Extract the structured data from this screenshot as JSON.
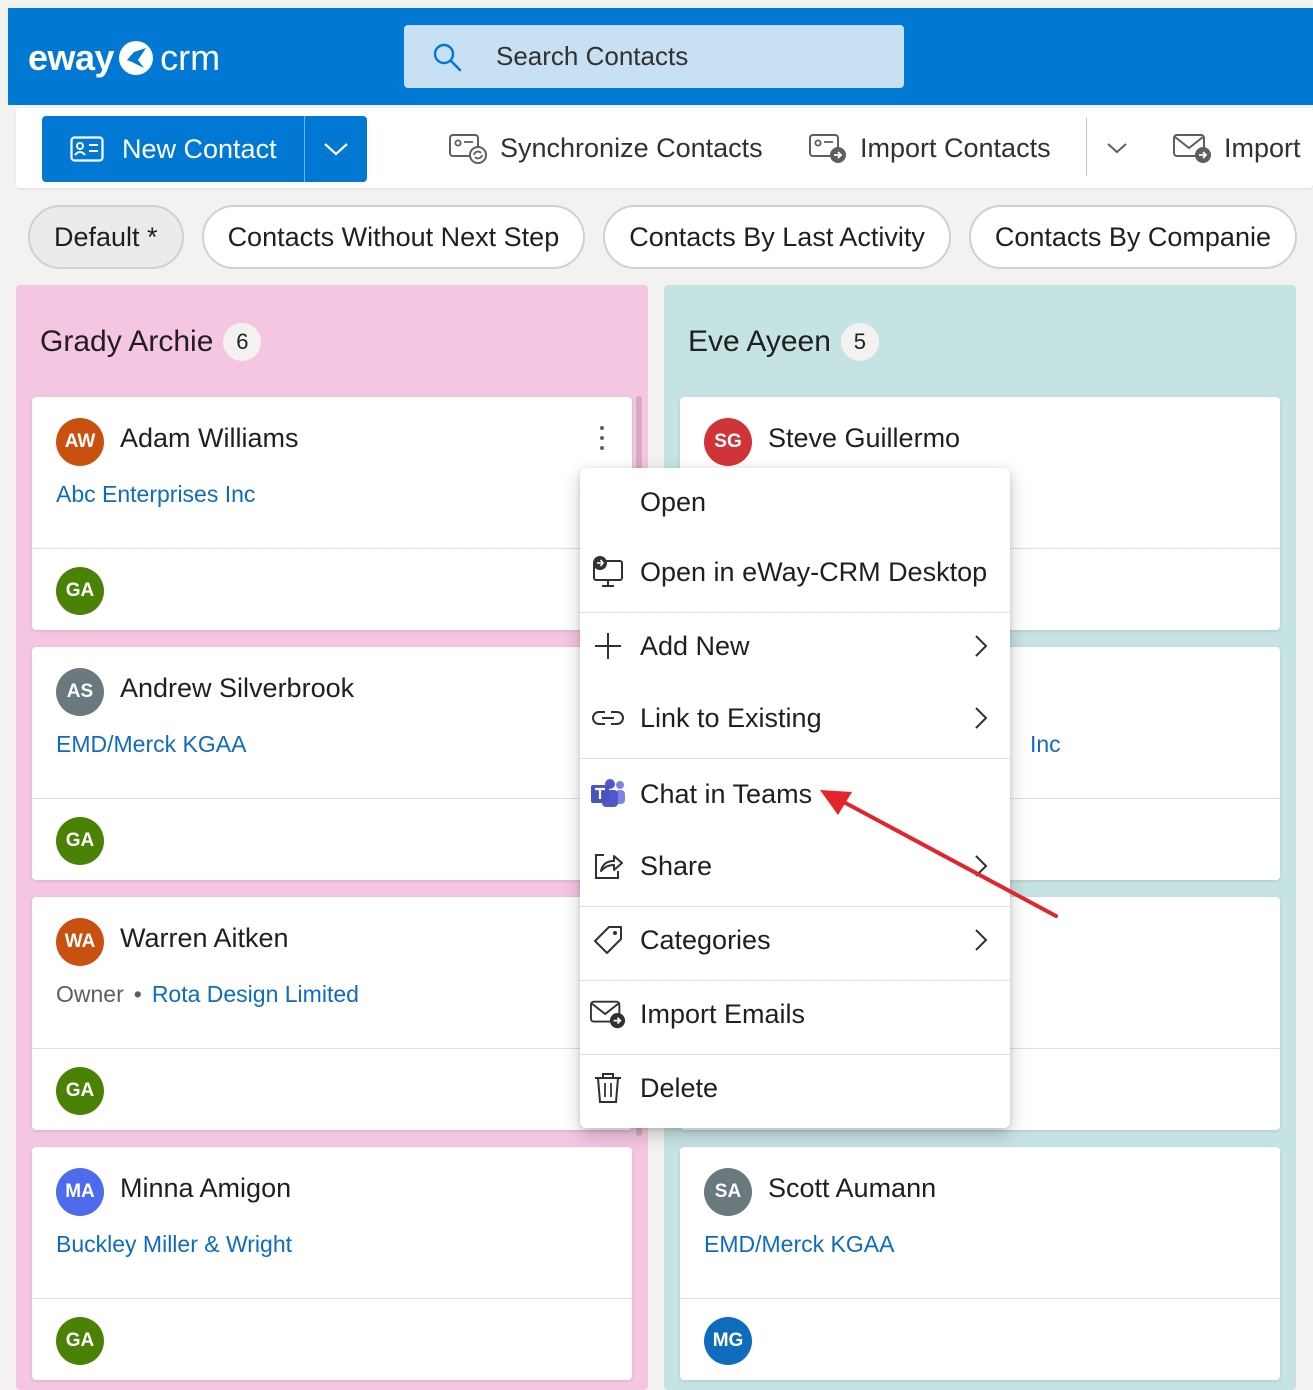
{
  "app": {
    "logo_bold": "eway",
    "logo_light": "crm",
    "brand_color": "#0078d4"
  },
  "search": {
    "placeholder": "Search Contacts"
  },
  "toolbar": {
    "new_contact": "New Contact",
    "synchronize": "Synchronize Contacts",
    "import_contacts": "Import Contacts",
    "import": "Import"
  },
  "views": [
    "Default *",
    "Contacts Without Next Step",
    "Contacts By Last Activity",
    "Contacts By Companie"
  ],
  "columns": [
    {
      "name": "Grady Archie",
      "count": "6",
      "color": "#f4c6e2",
      "cards": [
        {
          "initials": "AW",
          "avatar_color": "#ca5010",
          "name": "Adam Williams",
          "role": "",
          "company": "Abc Enterprises Inc",
          "owner": "GA",
          "owner_color": "#498205"
        },
        {
          "initials": "AS",
          "avatar_color": "#69797e",
          "name": "Andrew Silverbrook",
          "role": "",
          "company": "EMD/Merck KGAA",
          "owner": "GA",
          "owner_color": "#498205"
        },
        {
          "initials": "WA",
          "avatar_color": "#ca5010",
          "name": "Warren Aitken",
          "role": "Owner",
          "company": "Rota Design Limited",
          "owner": "GA",
          "owner_color": "#498205"
        },
        {
          "initials": "MA",
          "avatar_color": "#4f6bed",
          "name": "Minna Amigon",
          "role": "",
          "company": "Buckley Miller & Wright",
          "owner": "GA",
          "owner_color": "#498205"
        }
      ]
    },
    {
      "name": "Eve Ayeen",
      "count": "5",
      "color": "#c6e3e3",
      "cards": [
        {
          "initials": "SG",
          "avatar_color": "#d13438",
          "name": "Steve Guillermo",
          "company": ""
        },
        {
          "company_tail": "Inc"
        },
        {},
        {
          "initials": "SA",
          "avatar_color": "#69797e",
          "name": "Scott Aumann",
          "company": "EMD/Merck KGAA",
          "owner": "MG",
          "owner_color": "#0f6cbd"
        }
      ]
    }
  ],
  "context_menu": {
    "open": "Open",
    "open_desktop": "Open in eWay-CRM Desktop",
    "add_new": "Add New",
    "link_existing": "Link to Existing",
    "chat_teams": "Chat in Teams",
    "share": "Share",
    "categories": "Categories",
    "import_emails": "Import Emails",
    "delete": "Delete"
  },
  "annotation": {
    "arrow_color": "#e3242b"
  }
}
